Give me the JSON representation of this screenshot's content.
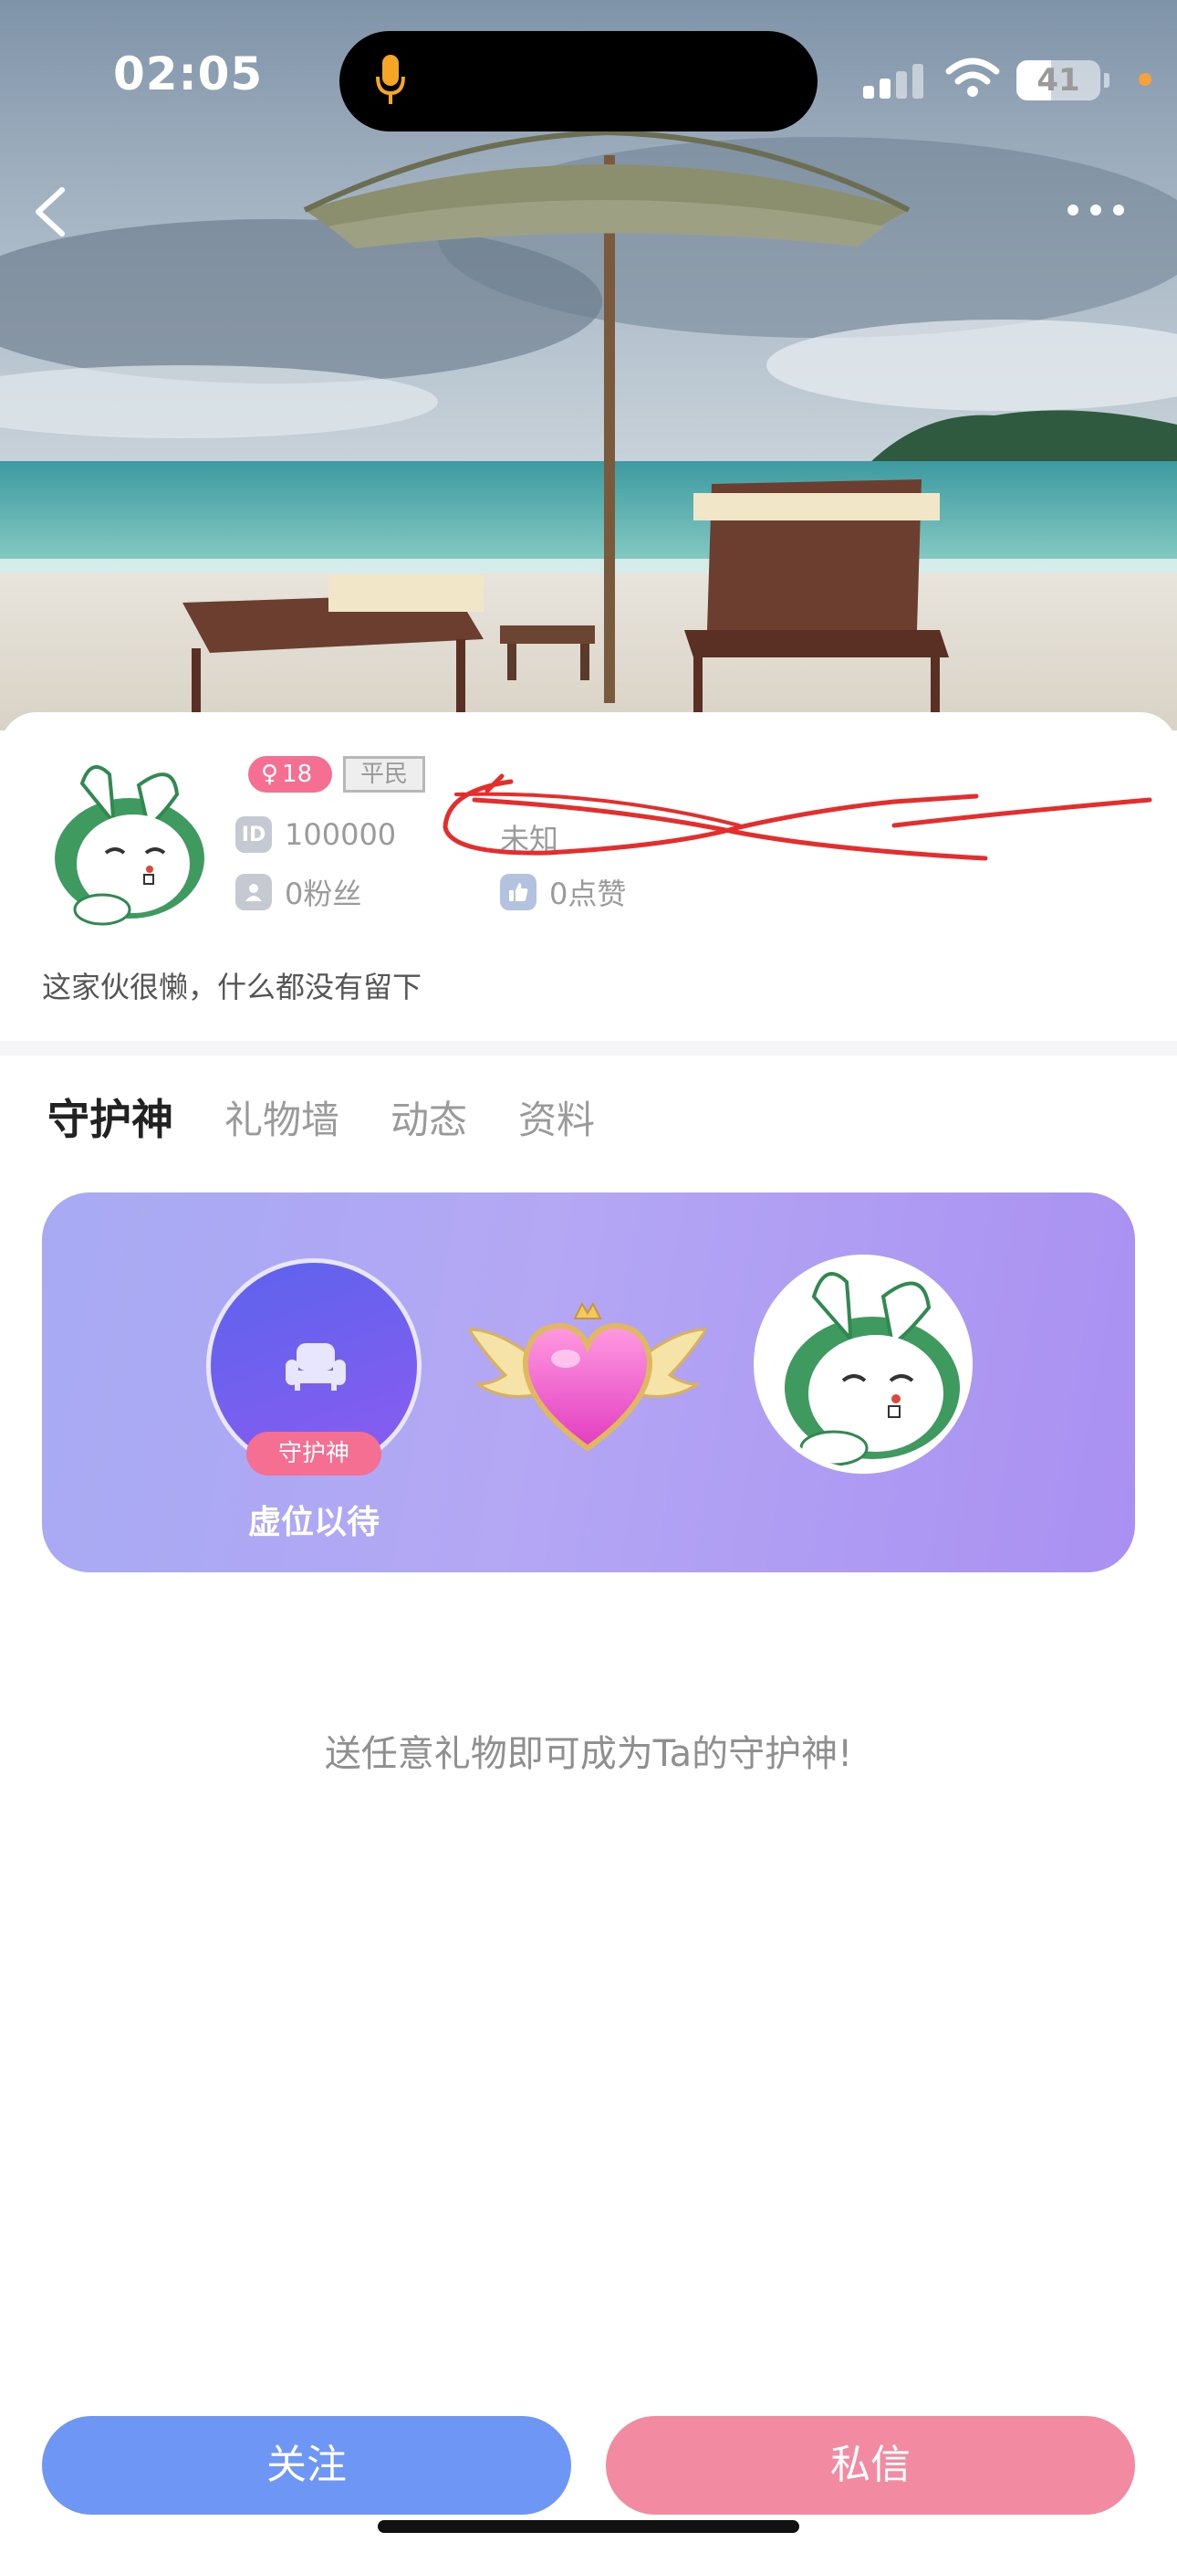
{
  "status_bar": {
    "time": "02:05",
    "battery": "41",
    "battery_level": 0.41
  },
  "nav": {
    "back_icon": "chevron-left-icon",
    "more_icon": "more-dots-icon"
  },
  "profile": {
    "age": "18",
    "rank": "平民",
    "id_icon_text": "ID",
    "id_value": "100000",
    "location": "未知",
    "fans": "0粉丝",
    "likes": "0点赞",
    "bio": "这家伙很懒，什么都没有留下"
  },
  "tabs": [
    {
      "label": "守护神",
      "active": true
    },
    {
      "label": "礼物墙",
      "active": false
    },
    {
      "label": "动态",
      "active": false
    },
    {
      "label": "资料",
      "active": false
    }
  ],
  "guardian": {
    "badge": "守护神",
    "seat_label": "虚位以待",
    "hint": "送任意礼物即可成为Ta的守护神!"
  },
  "actions": {
    "follow": "关注",
    "message": "私信"
  },
  "colors": {
    "accent_pink": "#f46f92",
    "follow_blue": "#6d96f5",
    "message_pink": "#f28aa2",
    "banner_purple": "#b4a7f4"
  }
}
